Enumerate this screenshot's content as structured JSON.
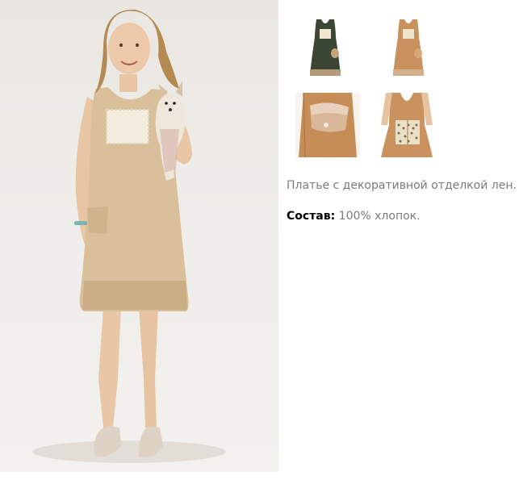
{
  "product": {
    "main_image": "model-in-beige-dress-holding-dog",
    "thumbnails": [
      {
        "name": "dress-dark-green-thumbnail"
      },
      {
        "name": "dress-tan-thumbnail"
      },
      {
        "name": "pocket-detail-thumbnail"
      },
      {
        "name": "lace-bodice-detail-thumbnail"
      }
    ],
    "description": "Платье с декоративной отделкой лен.",
    "composition_label": "Состав:",
    "composition_value": " 100% хлопок."
  },
  "colors": {
    "label": "#000000",
    "text": "#7a7a7a",
    "dress_beige": "#d9bf9a",
    "dress_dark": "#3b4634",
    "dress_tan": "#c8915e"
  }
}
